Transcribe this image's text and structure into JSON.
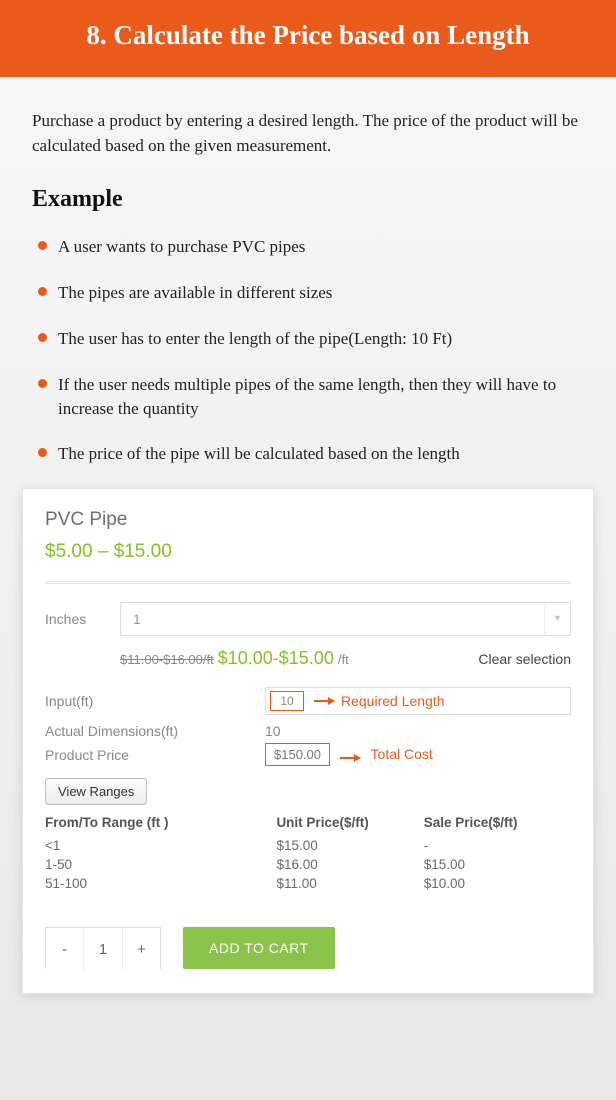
{
  "header": {
    "title": "8. Calculate the Price based on Length"
  },
  "intro": "Purchase a product by entering a desired length. The price of the product will be calculated based on the given measurement.",
  "example_heading": "Example",
  "bullets": [
    "A user wants to purchase PVC pipes",
    "The pipes are available in different sizes",
    "The user has to enter the length of the pipe(Length: 10 Ft)",
    "If the user needs multiple pipes of the same length, then they will have to increase the quantity",
    "The price of the pipe will be calculated based on the length"
  ],
  "product": {
    "title": "PVC Pipe",
    "price_range": "$5.00 – $15.00",
    "size_label": "Inches",
    "size_value": "1",
    "strike_price": "$11.00-$16.00/ft",
    "sale_price": "$10.00-$15.00",
    "per_ft": "/ft",
    "clear": "Clear selection",
    "input_label": "Input(ft)",
    "input_value": "10",
    "input_annot": "Required Length",
    "actual_label": "Actual Dimensions(ft)",
    "actual_value": "10",
    "price_label": "Product Price",
    "price_value": "$150.00",
    "price_annot": "Total Cost",
    "view_ranges": "View Ranges",
    "table": {
      "headers": [
        "From/To Range (ft )",
        "Unit Price($/ft)",
        "Sale Price($/ft)"
      ],
      "rows": [
        [
          "<1",
          "$15.00",
          "-"
        ],
        [
          "1-50",
          "$16.00",
          "$15.00"
        ],
        [
          "51-100",
          "$11.00",
          "$10.00"
        ]
      ]
    },
    "qty_minus": "-",
    "qty_value": "1",
    "qty_plus": "+",
    "add_to_cart": "ADD TO CART"
  }
}
